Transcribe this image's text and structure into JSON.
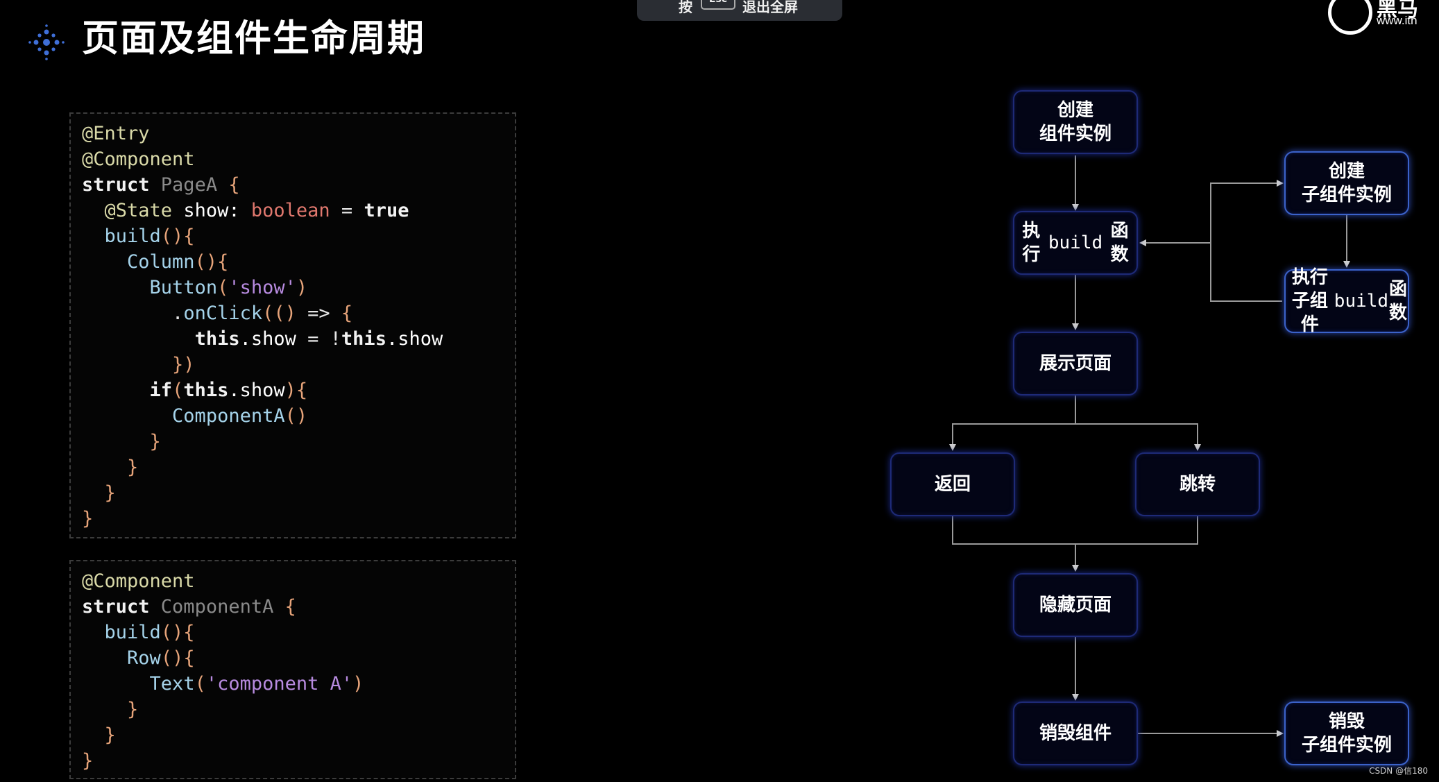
{
  "header": {
    "title": "页面及组件生命周期"
  },
  "esc_hint": {
    "prefix": "按",
    "key": "Esc",
    "suffix": "退出全屏"
  },
  "brand": {
    "name": "黑马",
    "url": "www.ith"
  },
  "watermark": "CSDN @信180",
  "code_block_1": [
    [
      [
        "dec",
        "@Entry"
      ]
    ],
    [
      [
        "dec",
        "@Component"
      ]
    ],
    [
      [
        "kw",
        "struct "
      ],
      [
        "cls",
        "PageA "
      ],
      [
        "br",
        "{"
      ]
    ],
    [
      [
        "op",
        "  "
      ],
      [
        "dec",
        "@State "
      ],
      [
        "prop",
        "show: "
      ],
      [
        "typ",
        "boolean"
      ],
      [
        "op",
        " = "
      ],
      [
        "kw",
        "true"
      ]
    ],
    [
      [
        "op",
        "  "
      ],
      [
        "fn",
        "build"
      ],
      [
        "br",
        "(){"
      ]
    ],
    [
      [
        "op",
        "    "
      ],
      [
        "fn",
        "Column"
      ],
      [
        "br",
        "(){"
      ]
    ],
    [
      [
        "op",
        "      "
      ],
      [
        "fn",
        "Button"
      ],
      [
        "br",
        "("
      ],
      [
        "str",
        "'show'"
      ],
      [
        "br",
        ")"
      ]
    ],
    [
      [
        "op",
        "        ."
      ],
      [
        "fn",
        "onClick"
      ],
      [
        "br",
        "(() "
      ],
      [
        "op",
        "=> "
      ],
      [
        "br",
        "{"
      ]
    ],
    [
      [
        "op",
        "          "
      ],
      [
        "kw",
        "this"
      ],
      [
        "prop",
        ".show "
      ],
      [
        "op",
        "= !"
      ],
      [
        "kw",
        "this"
      ],
      [
        "prop",
        ".show"
      ]
    ],
    [
      [
        "op",
        "        "
      ],
      [
        "br",
        "})"
      ]
    ],
    [
      [
        "op",
        "      "
      ],
      [
        "kw",
        "if"
      ],
      [
        "br",
        "("
      ],
      [
        "kw",
        "this"
      ],
      [
        "prop",
        ".show"
      ],
      [
        "br",
        "){"
      ]
    ],
    [
      [
        "op",
        "        "
      ],
      [
        "fn",
        "ComponentA"
      ],
      [
        "br",
        "()"
      ]
    ],
    [
      [
        "op",
        "      "
      ],
      [
        "br",
        "}"
      ]
    ],
    [
      [
        "op",
        "    "
      ],
      [
        "br",
        "}"
      ]
    ],
    [
      [
        "op",
        "  "
      ],
      [
        "br",
        "}"
      ]
    ],
    [
      [
        "br",
        "}"
      ]
    ]
  ],
  "code_block_2": [
    [
      [
        "dec",
        "@Component"
      ]
    ],
    [
      [
        "kw",
        "struct "
      ],
      [
        "cls",
        "ComponentA "
      ],
      [
        "br",
        "{"
      ]
    ],
    [
      [
        "op",
        "  "
      ],
      [
        "fn",
        "build"
      ],
      [
        "br",
        "(){"
      ]
    ],
    [
      [
        "op",
        "    "
      ],
      [
        "fn",
        "Row"
      ],
      [
        "br",
        "(){"
      ]
    ],
    [
      [
        "op",
        "      "
      ],
      [
        "fn",
        "Text"
      ],
      [
        "br",
        "("
      ],
      [
        "str",
        "'component A'"
      ],
      [
        "br",
        ")"
      ]
    ],
    [
      [
        "op",
        "    "
      ],
      [
        "br",
        "}"
      ]
    ],
    [
      [
        "op",
        "  "
      ],
      [
        "br",
        "}"
      ]
    ],
    [
      [
        "br",
        "}"
      ]
    ]
  ],
  "flow": {
    "create_component": "创建\n组件实例",
    "run_build": "执行\nbuild函数",
    "show_page": "展示页面",
    "back": "返回",
    "jump": "跳转",
    "hide_page": "隐藏页面",
    "destroy_component": "销毁组件",
    "create_child": "创建\n子组件实例",
    "run_child_build": "执行子组件\nbuild函数",
    "destroy_child": "销毁\n子组件实例"
  }
}
